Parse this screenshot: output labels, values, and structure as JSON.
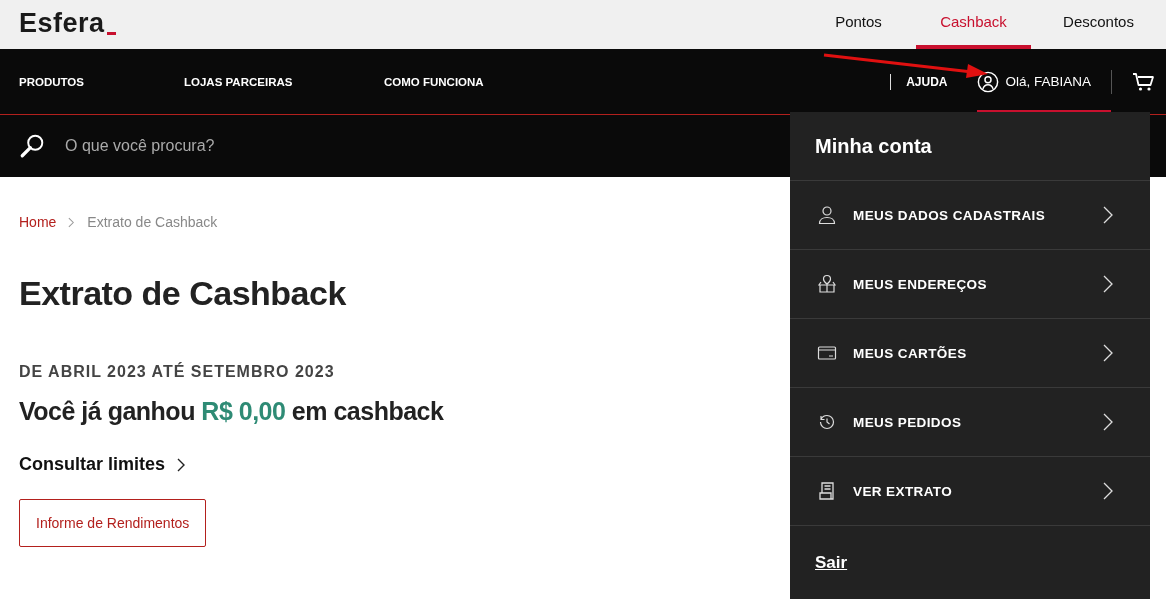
{
  "brand": {
    "name": "Esfera"
  },
  "top_tabs": [
    {
      "label": "Pontos",
      "selected": false
    },
    {
      "label": "Cashback",
      "selected": true
    },
    {
      "label": "Descontos",
      "selected": false
    }
  ],
  "nav": {
    "items": [
      "PRODUTOS",
      "LOJAS PARCEIRAS",
      "COMO FUNCIONA"
    ],
    "help": "AJUDA",
    "account": {
      "label": "Olá, FABIANA",
      "expanded": true
    }
  },
  "search": {
    "placeholder": "O que você procura?"
  },
  "breadcrumb": [
    "Home",
    "Extrato de Cashback"
  ],
  "title": "Extrato de Cashback",
  "period": "DE ABRIL 2023 ATÉ SETEMBRO 2023",
  "earned": {
    "prefix": "Você já ganhou",
    "amount": "R$ 0,00",
    "suffix": "em cashback"
  },
  "limits_link": "Consultar limites",
  "report_button": "Informe de Rendimentos",
  "account_menu": {
    "title": "Minha conta",
    "items": [
      {
        "kind": "profile",
        "label": "MEUS DADOS CADASTRAIS"
      },
      {
        "kind": "address",
        "label": "MEUS ENDEREÇOS"
      },
      {
        "kind": "card",
        "label": "MEUS CARTÕES"
      },
      {
        "kind": "history",
        "label": "MEUS PEDIDOS"
      },
      {
        "kind": "statement",
        "label": "VER EXTRATO"
      }
    ],
    "logout": "Sair"
  }
}
